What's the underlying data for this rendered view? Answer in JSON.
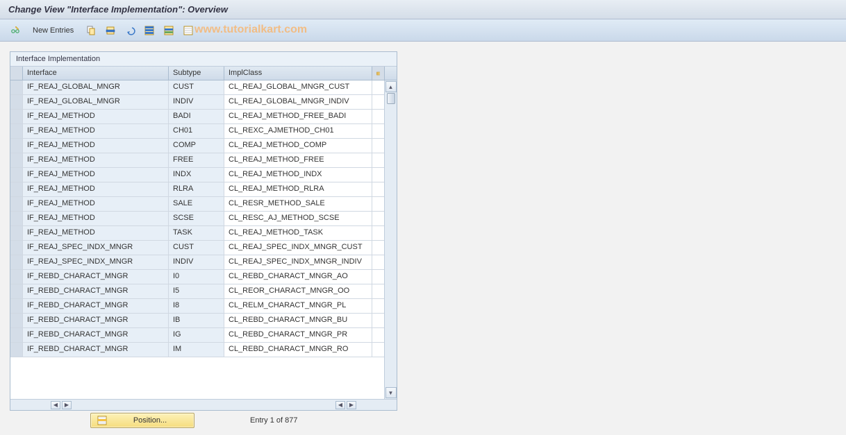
{
  "title": "Change View \"Interface Implementation\": Overview",
  "toolbar": {
    "new_entries_label": "New Entries"
  },
  "watermark": "www.tutorialkart.com",
  "panel": {
    "header": "Interface Implementation",
    "columns": {
      "interface": "Interface",
      "subtype": "Subtype",
      "implclass": "ImplClass"
    },
    "rows": [
      {
        "interface": "IF_REAJ_GLOBAL_MNGR",
        "subtype": "CUST",
        "implclass": "CL_REAJ_GLOBAL_MNGR_CUST"
      },
      {
        "interface": "IF_REAJ_GLOBAL_MNGR",
        "subtype": "INDIV",
        "implclass": "CL_REAJ_GLOBAL_MNGR_INDIV"
      },
      {
        "interface": "IF_REAJ_METHOD",
        "subtype": "BADI",
        "implclass": "CL_REAJ_METHOD_FREE_BADI"
      },
      {
        "interface": "IF_REAJ_METHOD",
        "subtype": "CH01",
        "implclass": "CL_REXC_AJMETHOD_CH01"
      },
      {
        "interface": "IF_REAJ_METHOD",
        "subtype": "COMP",
        "implclass": "CL_REAJ_METHOD_COMP"
      },
      {
        "interface": "IF_REAJ_METHOD",
        "subtype": "FREE",
        "implclass": "CL_REAJ_METHOD_FREE"
      },
      {
        "interface": "IF_REAJ_METHOD",
        "subtype": "INDX",
        "implclass": "CL_REAJ_METHOD_INDX"
      },
      {
        "interface": "IF_REAJ_METHOD",
        "subtype": "RLRA",
        "implclass": "CL_REAJ_METHOD_RLRA"
      },
      {
        "interface": "IF_REAJ_METHOD",
        "subtype": "SALE",
        "implclass": "CL_RESR_METHOD_SALE"
      },
      {
        "interface": "IF_REAJ_METHOD",
        "subtype": "SCSE",
        "implclass": "CL_RESC_AJ_METHOD_SCSE"
      },
      {
        "interface": "IF_REAJ_METHOD",
        "subtype": "TASK",
        "implclass": "CL_REAJ_METHOD_TASK"
      },
      {
        "interface": "IF_REAJ_SPEC_INDX_MNGR",
        "subtype": "CUST",
        "implclass": "CL_REAJ_SPEC_INDX_MNGR_CUST"
      },
      {
        "interface": "IF_REAJ_SPEC_INDX_MNGR",
        "subtype": "INDIV",
        "implclass": "CL_REAJ_SPEC_INDX_MNGR_INDIV"
      },
      {
        "interface": "IF_REBD_CHARACT_MNGR",
        "subtype": "I0",
        "implclass": "CL_REBD_CHARACT_MNGR_AO"
      },
      {
        "interface": "IF_REBD_CHARACT_MNGR",
        "subtype": "I5",
        "implclass": "CL_REOR_CHARACT_MNGR_OO"
      },
      {
        "interface": "IF_REBD_CHARACT_MNGR",
        "subtype": "I8",
        "implclass": "CL_RELM_CHARACT_MNGR_PL"
      },
      {
        "interface": "IF_REBD_CHARACT_MNGR",
        "subtype": "IB",
        "implclass": "CL_REBD_CHARACT_MNGR_BU"
      },
      {
        "interface": "IF_REBD_CHARACT_MNGR",
        "subtype": "IG",
        "implclass": "CL_REBD_CHARACT_MNGR_PR"
      },
      {
        "interface": "IF_REBD_CHARACT_MNGR",
        "subtype": "IM",
        "implclass": "CL_REBD_CHARACT_MNGR_RO"
      }
    ]
  },
  "footer": {
    "position_label": "Position...",
    "entry_text": "Entry 1 of 877"
  }
}
